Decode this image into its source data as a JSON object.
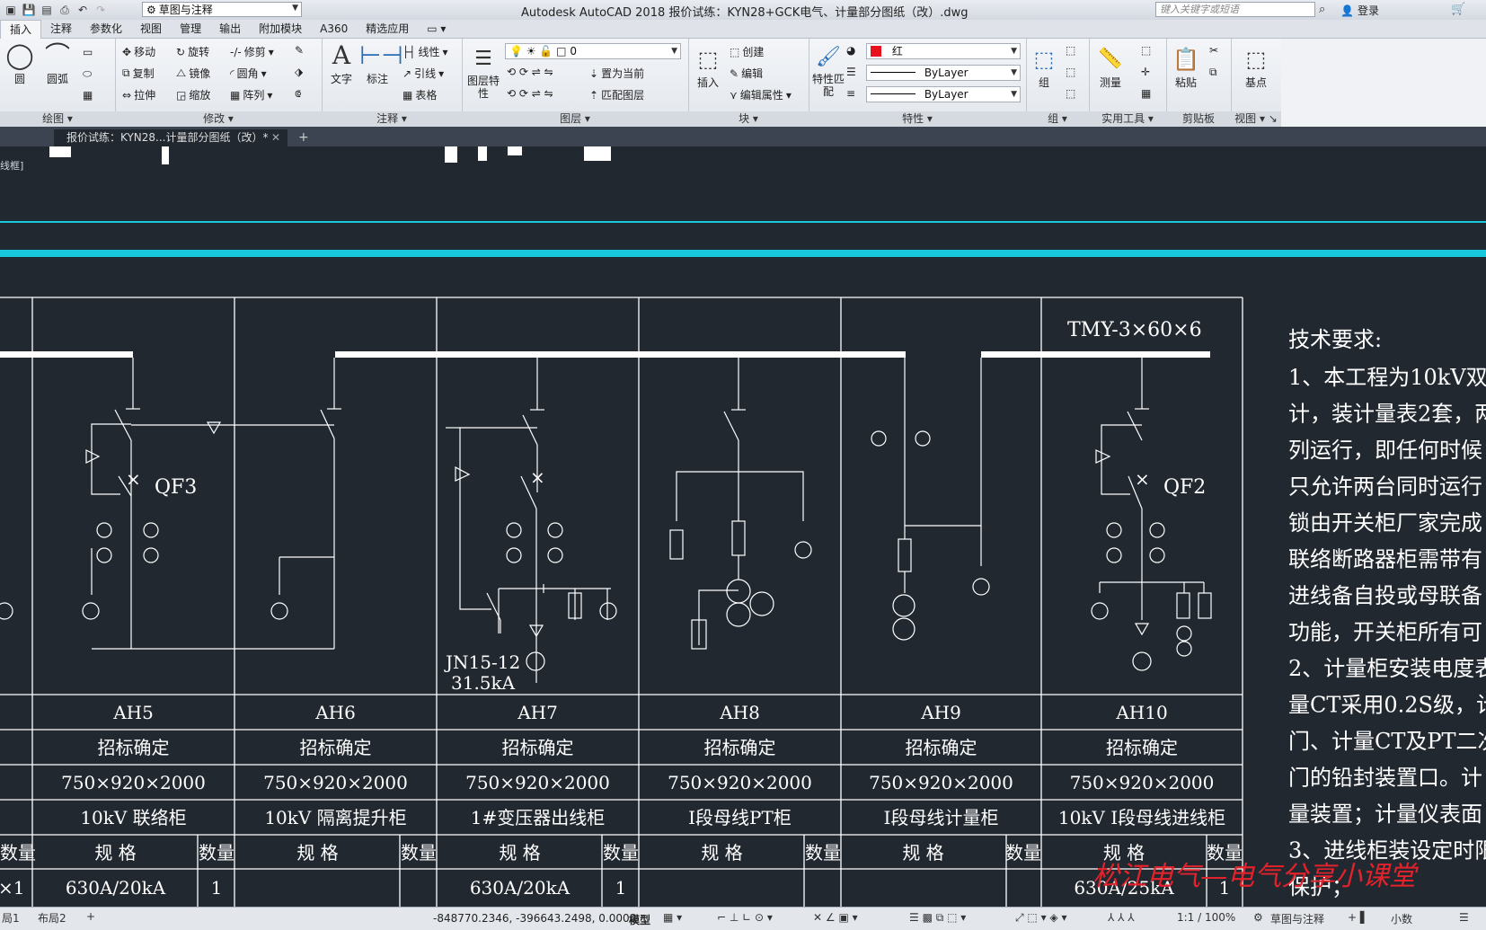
{
  "app": {
    "title": "Autodesk AutoCAD 2018    报价试练：KYN28+GCK电气、计量部分图纸（改）.dwg",
    "workspace": "草图与注释",
    "search_placeholder": "键入关键字或短语",
    "login": "登录"
  },
  "menu_tabs": [
    "插入",
    "注释",
    "参数化",
    "视图",
    "管理",
    "输出",
    "附加模块",
    "A360",
    "精选应用"
  ],
  "ribbon": {
    "draw": {
      "title": "绘图",
      "circle": "圆",
      "arc": "圆弧"
    },
    "modify": {
      "title": "修改",
      "move": "移动",
      "rotate": "旋转",
      "trim": "修剪",
      "copy": "复制",
      "mirror": "镜像",
      "fillet": "圆角",
      "stretch": "拉伸",
      "scale": "缩放",
      "array": "阵列"
    },
    "annotation": {
      "title": "注释",
      "text": "文字",
      "dim": "标注",
      "linear": "线性",
      "leader": "引线",
      "table": "表格"
    },
    "layers": {
      "title": "图层",
      "props": "图层特性",
      "layer_value": "0",
      "set_current": "置为当前",
      "match_layer": "匹配图层"
    },
    "block": {
      "title": "块",
      "insert": "插入",
      "create": "创建",
      "edit": "编辑",
      "edit_attr": "编辑属性"
    },
    "properties": {
      "title": "特性",
      "match": "特性匹配",
      "color": "红",
      "linetype": "ByLayer",
      "lineweight": "ByLayer",
      "color_hex": "#e8101c"
    },
    "groups": {
      "title": "组",
      "group": "组"
    },
    "utilities": {
      "title": "实用工具",
      "measure": "测量"
    },
    "clipboard": {
      "title": "剪贴板",
      "paste": "粘贴"
    },
    "view": {
      "title": "视图",
      "base": "基点"
    }
  },
  "doc_tab": "报价试练：KYN28...计量部分图纸（改）*",
  "viewport_label": "线框]",
  "drawing": {
    "busbar_label": "TMY-3×60×6",
    "qf3": "QF3",
    "qf2": "QF2",
    "jn_model": "JN15-12",
    "jn_rating": "31.5kA",
    "cabinets": [
      {
        "id": "AH5",
        "spec": "招标确定",
        "size": "750×920×2000",
        "name": "10kV 联络柜",
        "item_spec": "630A/20kA",
        "item_qty": "1"
      },
      {
        "id": "AH6",
        "spec": "招标确定",
        "size": "750×920×2000",
        "name": "10kV 隔离提升柜",
        "item_spec": "",
        "item_qty": ""
      },
      {
        "id": "AH7",
        "spec": "招标确定",
        "size": "750×920×2000",
        "name": "1#变压器出线柜",
        "item_spec": "630A/20kA",
        "item_qty": "1"
      },
      {
        "id": "AH8",
        "spec": "招标确定",
        "size": "750×920×2000",
        "name": "I段母线PT柜",
        "item_spec": "",
        "item_qty": ""
      },
      {
        "id": "AH9",
        "spec": "招标确定",
        "size": "750×920×2000",
        "name": "I段母线计量柜",
        "item_spec": "",
        "item_qty": ""
      },
      {
        "id": "AH10",
        "spec": "招标确定",
        "size": "750×920×2000",
        "name": "10kV I段母线进线柜",
        "item_spec": "630A/25kA",
        "item_qty": "1"
      }
    ],
    "col_spec_header": "规 格",
    "col_qty_header": "数量",
    "left_partial": {
      "qty_header": "数量",
      "cell": "×1"
    },
    "tech_title": "技术要求:",
    "tech_lines": [
      "1、本工程为10kV双",
      "计，装计量表2套，两",
      "列运行，即任何时候",
      "只允许两台同时运行",
      "锁由开关柜厂家完成",
      "联络断路器柜需带有",
      "进线备自投或母联备",
      "功能，开关柜所有可",
      "2、计量柜安装电度表",
      "量CT采用0.2S级，计",
      "门、计量CT及PT二次",
      "门的铅封装置口。计",
      "量装置；计量仪表面",
      "3、进线柜装设定时限",
      "保护；"
    ],
    "watermark": "松江电气—电气分享小课堂"
  },
  "layout_tabs": [
    "局1",
    "布局2"
  ],
  "status": {
    "coords": "-848770.2346, -396643.2498, 0.0000",
    "model": "模型",
    "scale": "1:1 / 100%",
    "workspace": "草图与注释",
    "units": "小数"
  }
}
